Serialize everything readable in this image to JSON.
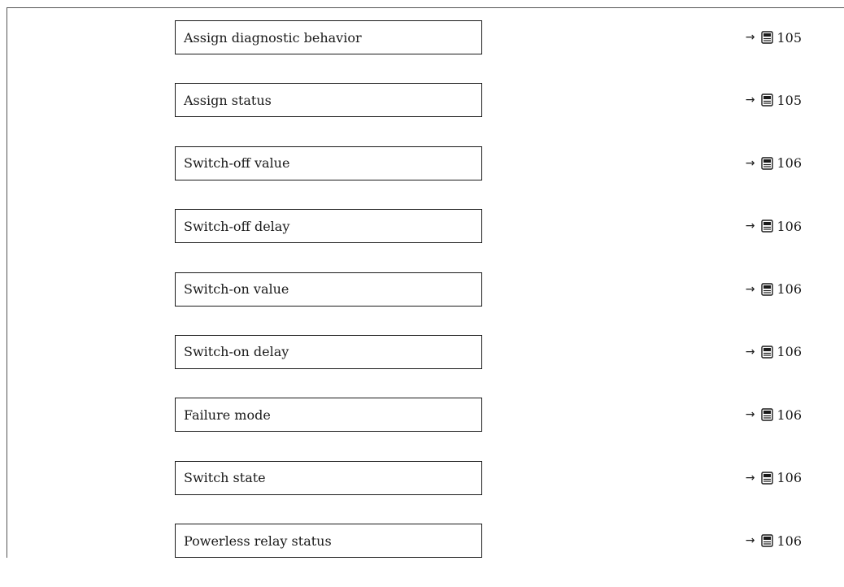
{
  "parameters": [
    {
      "label": "Assign diagnostic behavior",
      "arrow": "→",
      "page": "105"
    },
    {
      "label": "Assign status",
      "arrow": "→",
      "page": "105"
    },
    {
      "label": "Switch-off value",
      "arrow": "→",
      "page": "106"
    },
    {
      "label": "Switch-off delay",
      "arrow": "→",
      "page": "106"
    },
    {
      "label": "Switch-on value",
      "arrow": "→",
      "page": "106"
    },
    {
      "label": "Switch-on delay",
      "arrow": "→",
      "page": "106"
    },
    {
      "label": "Failure mode",
      "arrow": "→",
      "page": "106"
    },
    {
      "label": "Switch state",
      "arrow": "→",
      "page": "106"
    },
    {
      "label": "Powerless relay status",
      "arrow": "→",
      "page": "106"
    }
  ],
  "icons": {
    "page_reference": "book-page-icon"
  }
}
